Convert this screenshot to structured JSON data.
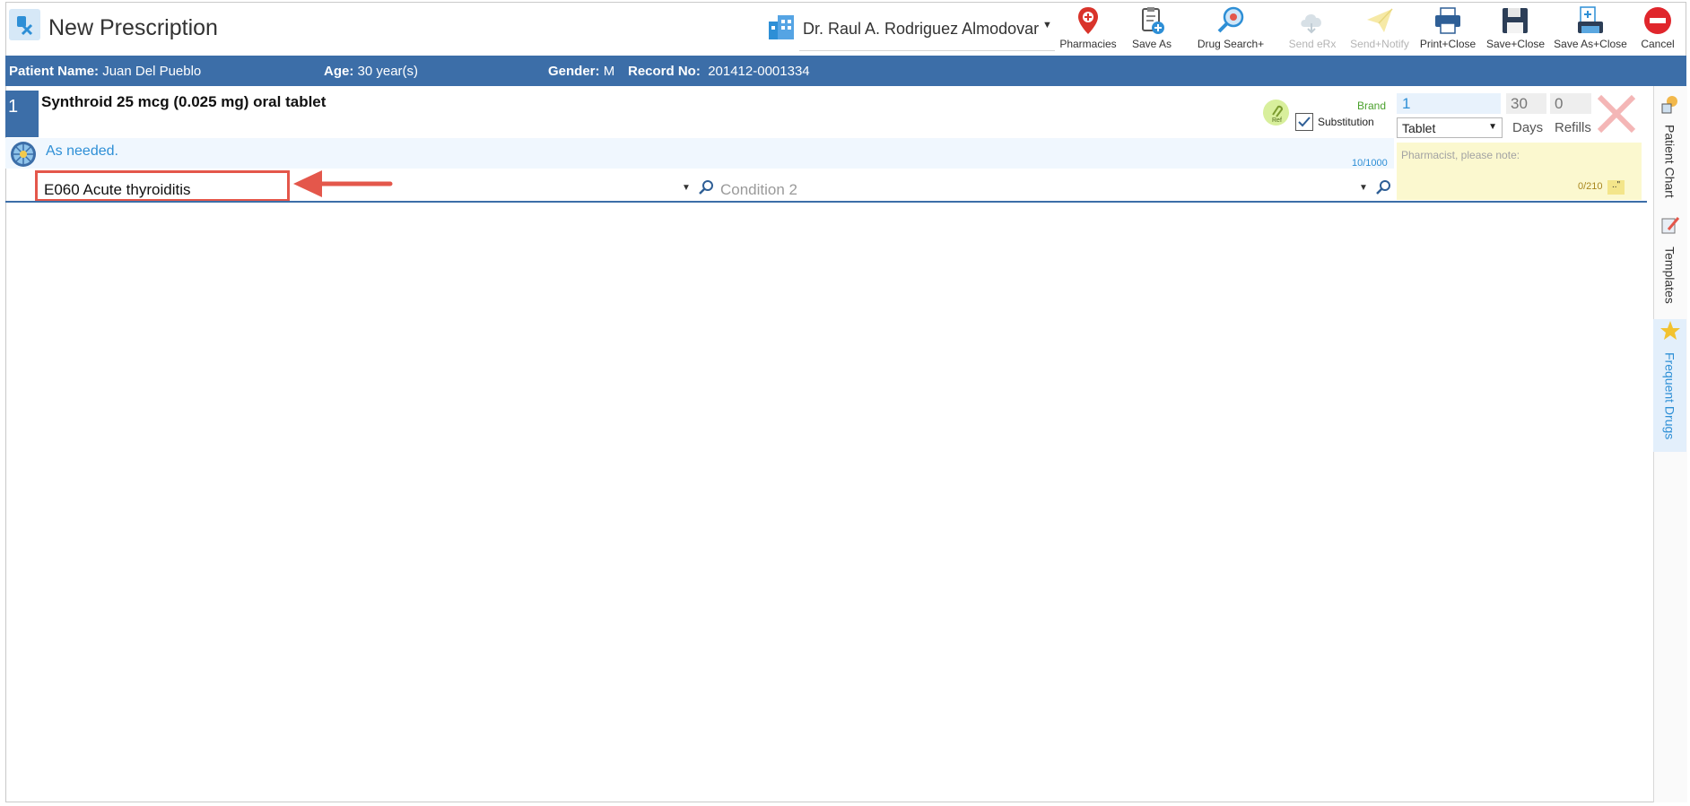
{
  "window": {
    "title": "New Prescription"
  },
  "doctor": {
    "name": "Dr. Raul A. Rodriguez Almodovar"
  },
  "toolbar": {
    "items": [
      {
        "label": "Pharmacies",
        "icon": "map-pin-icon",
        "enabled": true
      },
      {
        "label": "Save As",
        "icon": "clipboard-add-icon",
        "enabled": true
      },
      {
        "label": "Drug Search+",
        "icon": "drug-search-icon",
        "enabled": true
      },
      {
        "label": "Send eRx",
        "icon": "cloud-send-icon",
        "enabled": false
      },
      {
        "label": "Send+Notify",
        "icon": "paper-plane-icon",
        "enabled": false
      },
      {
        "label": "Print+Close",
        "icon": "printer-icon",
        "enabled": true
      },
      {
        "label": "Save+Close",
        "icon": "floppy-disk-icon",
        "enabled": true
      },
      {
        "label": "Save As+Close",
        "icon": "save-as-close-icon",
        "enabled": true
      },
      {
        "label": "Cancel",
        "icon": "cancel-icon",
        "enabled": true
      }
    ]
  },
  "patient": {
    "name_label": "Patient Name:",
    "name": "Juan Del Pueblo",
    "age_label": "Age:",
    "age": "30 year(s)",
    "gender_label": "Gender:",
    "gender": "M",
    "record_label": "Record No:",
    "record": "201412-0001334"
  },
  "prescription": {
    "number": "1",
    "drug": "Synthroid 25 mcg (0.025 mg) oral tablet",
    "sig": "As needed.",
    "sig_count": "10/1000",
    "brand_label": "Brand",
    "ref_label": "Ref",
    "substitution_label": "Substitution",
    "substitution_checked": true,
    "quantity": "1",
    "form": "Tablet",
    "days": "30",
    "days_label": "Days",
    "refills": "0",
    "refills_label": "Refills",
    "condition1": "E060 Acute thyroiditis",
    "condition2_placeholder": "Condition 2",
    "note_placeholder": "Pharmacist, please note:",
    "note_count": "0/210",
    "note_button": "..\""
  },
  "side_tabs": [
    {
      "label": "Patient Chart",
      "icon": "patient-chart-icon",
      "active": false
    },
    {
      "label": "Templates",
      "icon": "templates-icon",
      "active": false
    },
    {
      "label": "Frequent Drugs",
      "icon": "star-icon",
      "active": true
    }
  ],
  "colors": {
    "accent": "#3c6ea8",
    "link": "#2e8fd6",
    "highlight": "#e4574b",
    "note_bg": "#fbf8cf"
  }
}
